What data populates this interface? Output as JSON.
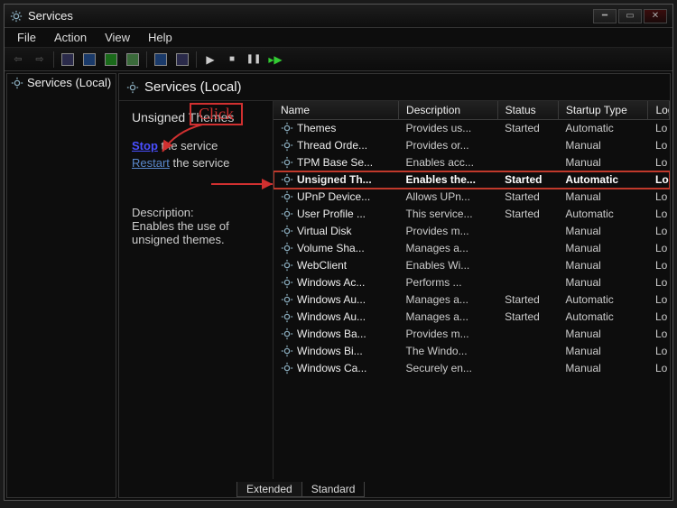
{
  "window": {
    "title": "Services"
  },
  "menubar": [
    "File",
    "Action",
    "View",
    "Help"
  ],
  "sidebar": {
    "item": "Services (Local)"
  },
  "main": {
    "header": "Services (Local)",
    "selected_service": "Unsigned Themes",
    "actions": {
      "stop_link": "Stop",
      "stop_suffix": " the service",
      "restart_link": "Restart",
      "restart_suffix": " the service"
    },
    "description_label": "Description:",
    "description_text": "Enables the use of unsigned themes."
  },
  "columns": [
    "Name",
    "Description",
    "Status",
    "Startup Type",
    "Log On As"
  ],
  "services": [
    {
      "name": "Themes",
      "desc": "Provides us...",
      "status": "Started",
      "startup": "Automatic",
      "logon": "Local System"
    },
    {
      "name": "Thread Orde...",
      "desc": "Provides or...",
      "status": "",
      "startup": "Manual",
      "logon": "Local System"
    },
    {
      "name": "TPM Base Se...",
      "desc": "Enables acc...",
      "status": "",
      "startup": "Manual",
      "logon": "Local System"
    },
    {
      "name": "Unsigned Th...",
      "desc": "Enables the...",
      "status": "Started",
      "startup": "Automatic",
      "logon": "Local System",
      "selected": true
    },
    {
      "name": "UPnP Device...",
      "desc": "Allows UPn...",
      "status": "Started",
      "startup": "Manual",
      "logon": "Local System"
    },
    {
      "name": "User Profile ...",
      "desc": "This service...",
      "status": "Started",
      "startup": "Automatic",
      "logon": "Local System"
    },
    {
      "name": "Virtual Disk",
      "desc": "Provides m...",
      "status": "",
      "startup": "Manual",
      "logon": "Local System"
    },
    {
      "name": "Volume Sha...",
      "desc": "Manages a...",
      "status": "",
      "startup": "Manual",
      "logon": "Local System"
    },
    {
      "name": "WebClient",
      "desc": "Enables Wi...",
      "status": "",
      "startup": "Manual",
      "logon": "Local System"
    },
    {
      "name": "Windows Ac...",
      "desc": "Performs ...",
      "status": "",
      "startup": "Manual",
      "logon": "Local System"
    },
    {
      "name": "Windows Au...",
      "desc": "Manages a...",
      "status": "Started",
      "startup": "Automatic",
      "logon": "Local System"
    },
    {
      "name": "Windows Au...",
      "desc": "Manages a...",
      "status": "Started",
      "startup": "Automatic",
      "logon": "Local System"
    },
    {
      "name": "Windows Ba...",
      "desc": "Provides m...",
      "status": "",
      "startup": "Manual",
      "logon": "Local System"
    },
    {
      "name": "Windows Bi...",
      "desc": "The Windo...",
      "status": "",
      "startup": "Manual",
      "logon": "Local System"
    },
    {
      "name": "Windows Ca...",
      "desc": "Securely en...",
      "status": "",
      "startup": "Manual",
      "logon": "Local System"
    }
  ],
  "tabs": [
    "Extended",
    "Standard"
  ],
  "annotation": {
    "click": "Click"
  }
}
